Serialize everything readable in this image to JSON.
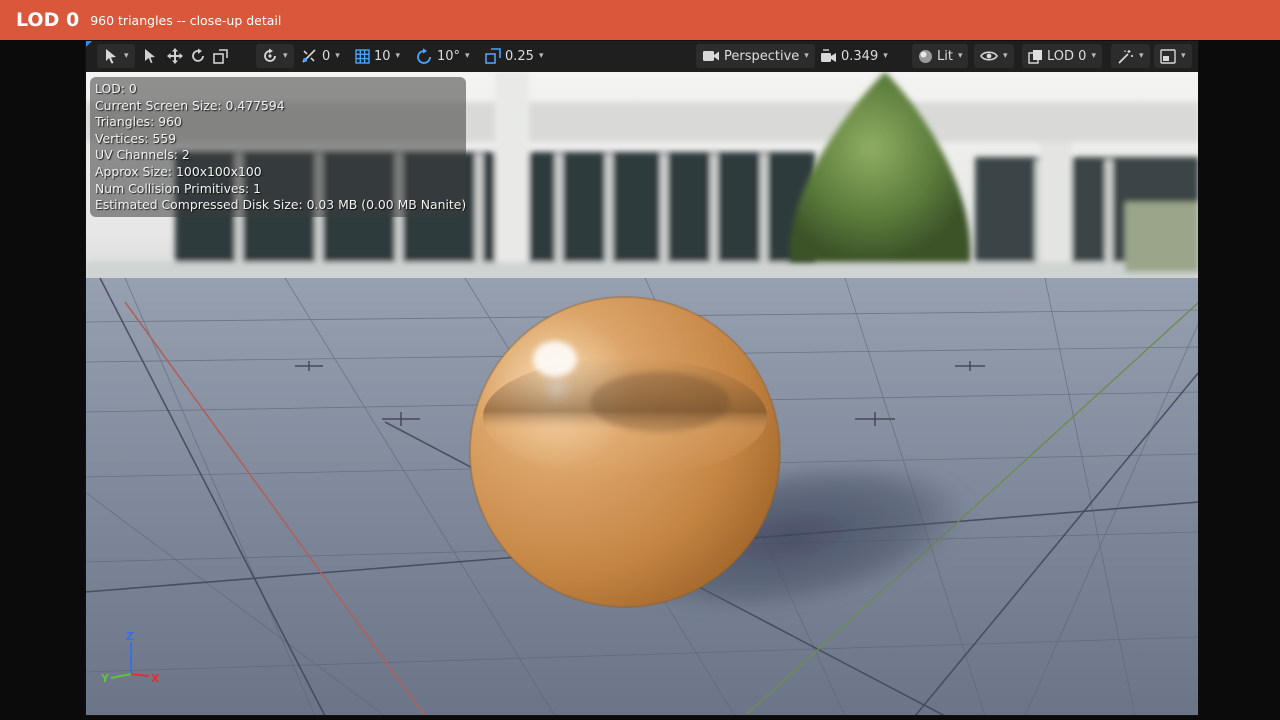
{
  "banner": {
    "title": "LOD 0",
    "subtitle": "960 triangles -- close-up detail"
  },
  "toolbar": {
    "translate_snap_value": "0",
    "grid_snap_value": "10",
    "rotate_snap_value": "10°",
    "scale_snap_value": "0.25",
    "view_mode_label": "Perspective",
    "camera_speed_value": "0.349",
    "lighting_mode_label": "Lit",
    "lod_selector_label": "LOD 0"
  },
  "stats": {
    "lines": [
      "LOD: 0",
      "Current Screen Size: 0.477594",
      "Triangles: 960",
      "Vertices: 559",
      "UV Channels: 2",
      "Approx Size: 100x100x100",
      "Num Collision Primitives: 1",
      "Estimated Compressed Disk Size: 0.03 MB (0.00 MB Nanite)"
    ]
  },
  "axes": {
    "z": "Z",
    "y": "Y",
    "x": "X"
  },
  "colors": {
    "banner": "#d9583b",
    "toolbar": "#1f1f1f",
    "floor": "#7d8799",
    "sphere": "#d59a55",
    "axis_x": "#e03030",
    "axis_y": "#62c23a",
    "axis_z": "#3a6fe0"
  }
}
